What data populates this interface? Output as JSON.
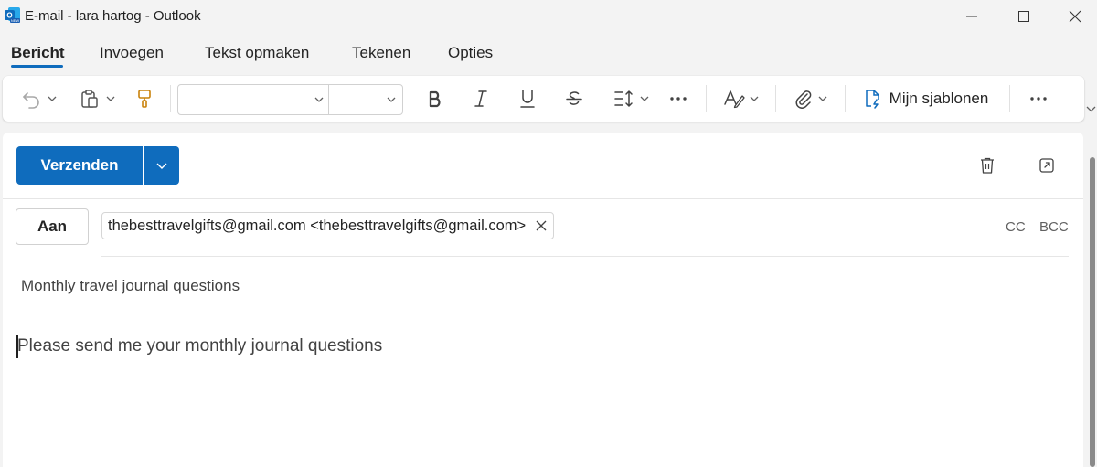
{
  "window": {
    "title": "E-mail - lara hartog - Outlook",
    "app_icon": "outlook-new-icon"
  },
  "tabs": [
    {
      "label": "Bericht",
      "active": true
    },
    {
      "label": "Invoegen",
      "active": false
    },
    {
      "label": "Tekst opmaken",
      "active": false
    },
    {
      "label": "Tekenen",
      "active": false
    },
    {
      "label": "Opties",
      "active": false
    }
  ],
  "ribbon": {
    "font_name": "",
    "font_size": "",
    "templates_label": "Mijn sjablonen",
    "icons": [
      "undo-icon",
      "paste-icon",
      "format-painter-icon",
      "bold-icon",
      "italic-icon",
      "underline-icon",
      "strikethrough-icon",
      "line-spacing-icon",
      "more-icon",
      "editor-icon",
      "attach-icon",
      "templates-icon",
      "more-icon"
    ]
  },
  "compose": {
    "send_label": "Verzenden",
    "to_label": "Aan",
    "recipient": "thebesttravelgifts@gmail.com <thebesttravelgifts@gmail.com>",
    "cc_label": "CC",
    "bcc_label": "BCC",
    "subject": "Monthly travel journal questions",
    "body": "Please send me your monthly journal questions"
  },
  "colors": {
    "accent": "#0f6cbd",
    "background": "#f3f3f3"
  }
}
